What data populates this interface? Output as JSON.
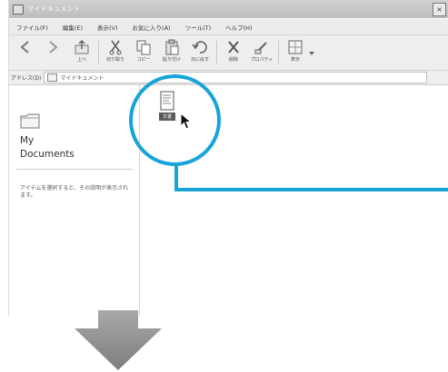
{
  "window": {
    "title": "マイドキュメント",
    "close_glyph": "×"
  },
  "menu": [
    "ファイル(F)",
    "編集(E)",
    "表示(V)",
    "お気に入り(A)",
    "ツール(T)",
    "ヘルプ(H)"
  ],
  "toolbar": {
    "back": "",
    "forward": "",
    "up": "上へ",
    "cut": "切り取り",
    "copy": "コピー",
    "paste": "貼り付け",
    "undo": "元に戻す",
    "delete": "削除",
    "properties": "プロパティ",
    "views": "表示"
  },
  "address": {
    "label": "アドレス(D)",
    "value": "マイドキュメント"
  },
  "left_pane": {
    "title_line1": "My",
    "title_line2": "Documents",
    "hint": "アイテムを選択すると、その説明が表示されます。"
  },
  "file": {
    "caption": "文書"
  },
  "colors": {
    "callout": "#19a4d7",
    "arrow": "#8c8c8c"
  }
}
